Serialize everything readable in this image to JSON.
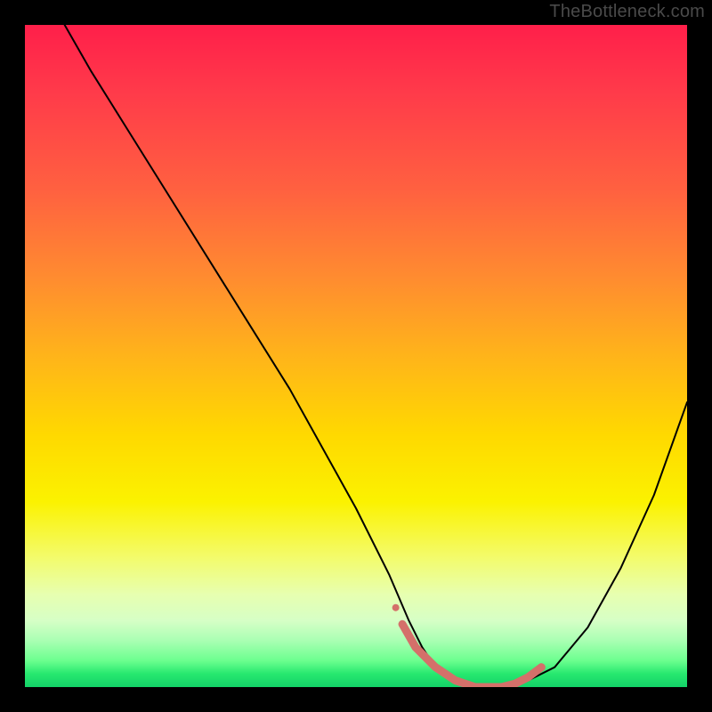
{
  "watermark": "TheBottleneck.com",
  "chart_data": {
    "type": "line",
    "title": "",
    "xlabel": "",
    "ylabel": "",
    "xlim": [
      0,
      100
    ],
    "ylim": [
      0,
      100
    ],
    "background_gradient": {
      "stops": [
        {
          "pos": 0,
          "color": "#ff1f4a"
        },
        {
          "pos": 10,
          "color": "#ff3a4a"
        },
        {
          "pos": 25,
          "color": "#ff6140"
        },
        {
          "pos": 38,
          "color": "#ff8b30"
        },
        {
          "pos": 50,
          "color": "#ffb41a"
        },
        {
          "pos": 62,
          "color": "#ffd900"
        },
        {
          "pos": 72,
          "color": "#fbf200"
        },
        {
          "pos": 80,
          "color": "#f4fb66"
        },
        {
          "pos": 86,
          "color": "#e7ffb0"
        },
        {
          "pos": 90,
          "color": "#d6ffc6"
        },
        {
          "pos": 93,
          "color": "#a9ffb3"
        },
        {
          "pos": 96,
          "color": "#6cff8f"
        },
        {
          "pos": 98,
          "color": "#27e86f"
        },
        {
          "pos": 100,
          "color": "#13d268"
        }
      ]
    },
    "series": [
      {
        "name": "bottleneck-curve",
        "color": "#000000",
        "stroke_width": 2,
        "x": [
          6,
          10,
          15,
          20,
          25,
          30,
          35,
          40,
          45,
          50,
          55,
          58,
          60,
          62,
          65,
          68,
          70,
          72,
          75,
          80,
          85,
          90,
          95,
          100
        ],
        "y": [
          100,
          93,
          85,
          77,
          69,
          61,
          53,
          45,
          36,
          27,
          17,
          10,
          6,
          3,
          1,
          0,
          0,
          0,
          0.5,
          3,
          9,
          18,
          29,
          43
        ]
      },
      {
        "name": "optimal-region-highlight",
        "color": "#d4706a",
        "stroke_width": 9,
        "x": [
          57,
          59,
          62,
          65,
          68,
          70,
          72,
          74,
          76,
          78
        ],
        "y": [
          9.5,
          6,
          3,
          1,
          0,
          0,
          0,
          0.5,
          1.5,
          3
        ]
      }
    ],
    "markers": [
      {
        "name": "highlight-dot-1",
        "x": 56,
        "y": 12,
        "r": 4,
        "color": "#d4706a"
      },
      {
        "name": "highlight-dot-2",
        "x": 58.5,
        "y": 7,
        "r": 4,
        "color": "#d4706a"
      }
    ]
  }
}
